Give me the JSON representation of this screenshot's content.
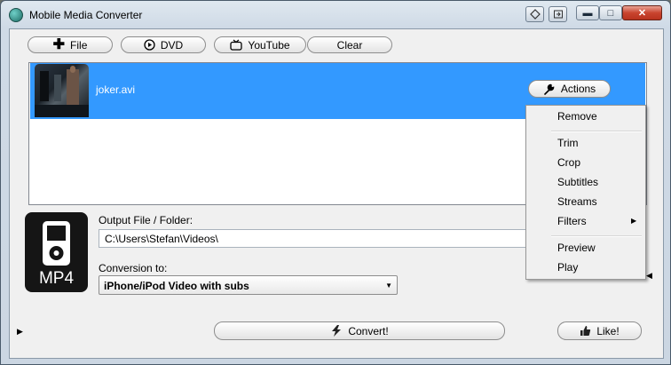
{
  "window": {
    "title": "Mobile Media Converter",
    "caption_buttons": {
      "minimize": "▬",
      "maximize": "□",
      "close": "✕"
    }
  },
  "toolbar": {
    "file_label": "File",
    "dvd_label": "DVD",
    "youtube_label": "YouTube",
    "clear_label": "Clear"
  },
  "file_list": {
    "items": [
      {
        "name": "joker.avi"
      }
    ],
    "actions_label": "Actions"
  },
  "actions_menu": {
    "items": [
      "Remove",
      "Trim",
      "Crop",
      "Subtitles",
      "Streams",
      "Filters",
      "Preview",
      "Play"
    ]
  },
  "output": {
    "label": "Output File / Folder:",
    "path": "C:\\Users\\Stefan\\Videos\\"
  },
  "conversion": {
    "label": "Conversion to:",
    "selected": "iPhone/iPod Video with subs"
  },
  "format_badge": {
    "text": "MP4"
  },
  "buttons": {
    "convert_label": "Convert!",
    "like_label": "Like!"
  },
  "colors": {
    "selection": "#3399ff",
    "window_bg": "#f0f0f0",
    "close_button": "#c9442f"
  }
}
